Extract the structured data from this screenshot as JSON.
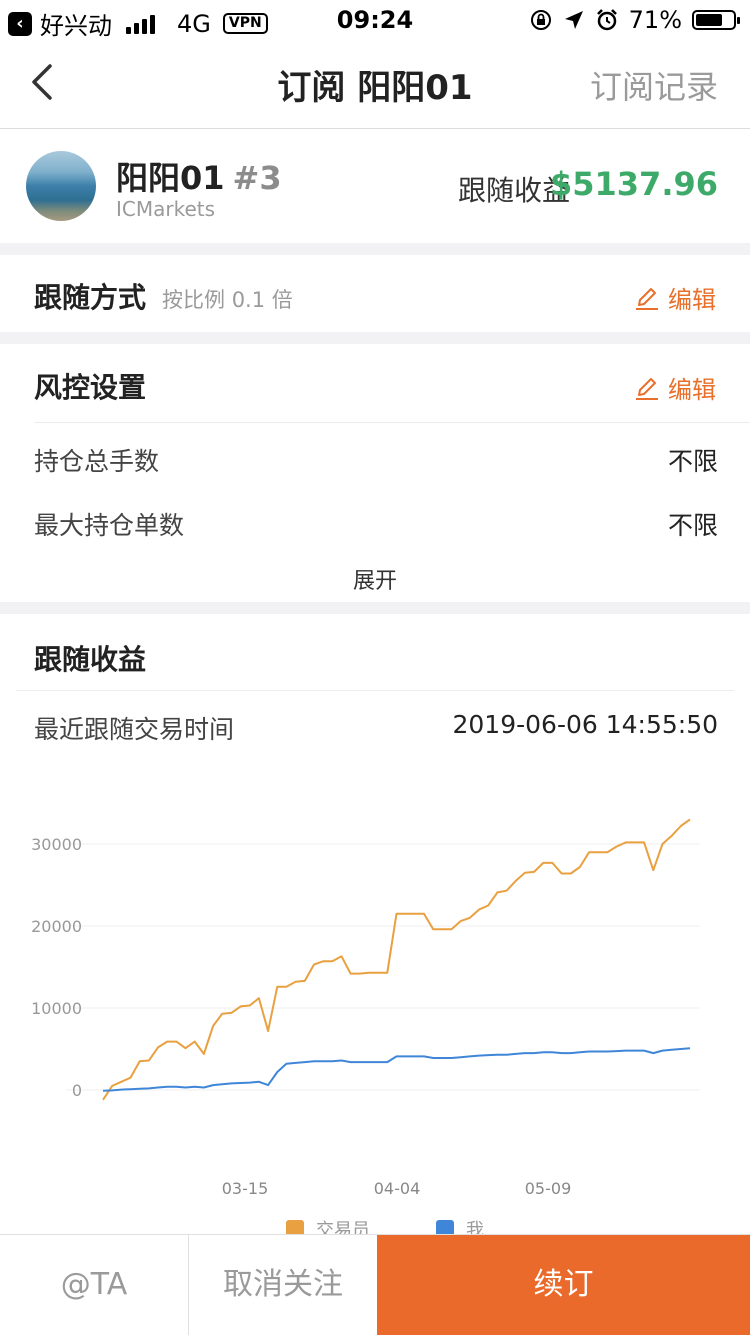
{
  "status_bar": {
    "carrier": "好兴动",
    "network": "4G",
    "vpn": "VPN",
    "time": "09:24",
    "battery": "71%",
    "battery_level": 0.71
  },
  "nav": {
    "title": "订阅 阳阳01",
    "right_label": "订阅记录"
  },
  "trader": {
    "name": "阳阳01",
    "rank": "#3",
    "broker": "ICMarkets",
    "profit_label": "跟随收益",
    "profit_value": "$5137.96"
  },
  "follow_mode": {
    "title": "跟随方式",
    "subtitle": "按比例 0.1 倍",
    "edit_label": "编辑"
  },
  "risk": {
    "title": "风控设置",
    "edit_label": "编辑",
    "items": [
      {
        "label": "持仓总手数",
        "value": "不限"
      },
      {
        "label": "最大持仓单数",
        "value": "不限"
      }
    ],
    "expand_label": "展开"
  },
  "earnings": {
    "title": "跟随收益",
    "last_trade_label": "最近跟随交易时间",
    "last_trade_value": "2019-06-06 14:55:50"
  },
  "chart_data": {
    "type": "line",
    "title": "",
    "xlabel": "",
    "ylabel": "",
    "x_ticks": [
      "03-15",
      "04-04",
      "05-09"
    ],
    "y_ticks": [
      0,
      10000,
      20000,
      30000
    ],
    "ylim": [
      -2000,
      34000
    ],
    "grid": true,
    "legend_position": "bottom",
    "series": [
      {
        "name": "交易员",
        "color": "#e9a040",
        "values": [
          -1200,
          500,
          1000,
          1500,
          3500,
          3600,
          5200,
          5900,
          5900,
          5100,
          5900,
          4400,
          7800,
          9300,
          9400,
          10200,
          10300,
          11200,
          7200,
          12600,
          12600,
          13200,
          13300,
          15300,
          15700,
          15700,
          16300,
          14200,
          14200,
          14300,
          14300,
          14300,
          21500,
          21500,
          21500,
          21500,
          19600,
          19600,
          19600,
          20600,
          21000,
          22000,
          22500,
          24100,
          24300,
          25500,
          26500,
          26600,
          27700,
          27700,
          26400,
          26400,
          27200,
          29000,
          29000,
          29000,
          29700,
          30200,
          30200,
          30200,
          26800,
          30000,
          31000,
          32200,
          33000
        ]
      },
      {
        "name": "我",
        "color": "#3f86d8",
        "values": [
          -100,
          -50,
          50,
          100,
          150,
          200,
          300,
          400,
          400,
          300,
          400,
          300,
          600,
          700,
          800,
          850,
          900,
          1000,
          600,
          2200,
          3200,
          3300,
          3400,
          3500,
          3500,
          3500,
          3600,
          3400,
          3400,
          3400,
          3400,
          3400,
          4100,
          4100,
          4100,
          4100,
          3900,
          3900,
          3900,
          4000,
          4100,
          4200,
          4250,
          4300,
          4300,
          4400,
          4500,
          4500,
          4600,
          4600,
          4500,
          4500,
          4600,
          4700,
          4700,
          4700,
          4750,
          4800,
          4800,
          4800,
          4500,
          4800,
          4900,
          5000,
          5100
        ]
      }
    ]
  },
  "bottom_bar": {
    "at_label": "@TA",
    "unfollow_label": "取消关注",
    "renew_label": "续订"
  }
}
